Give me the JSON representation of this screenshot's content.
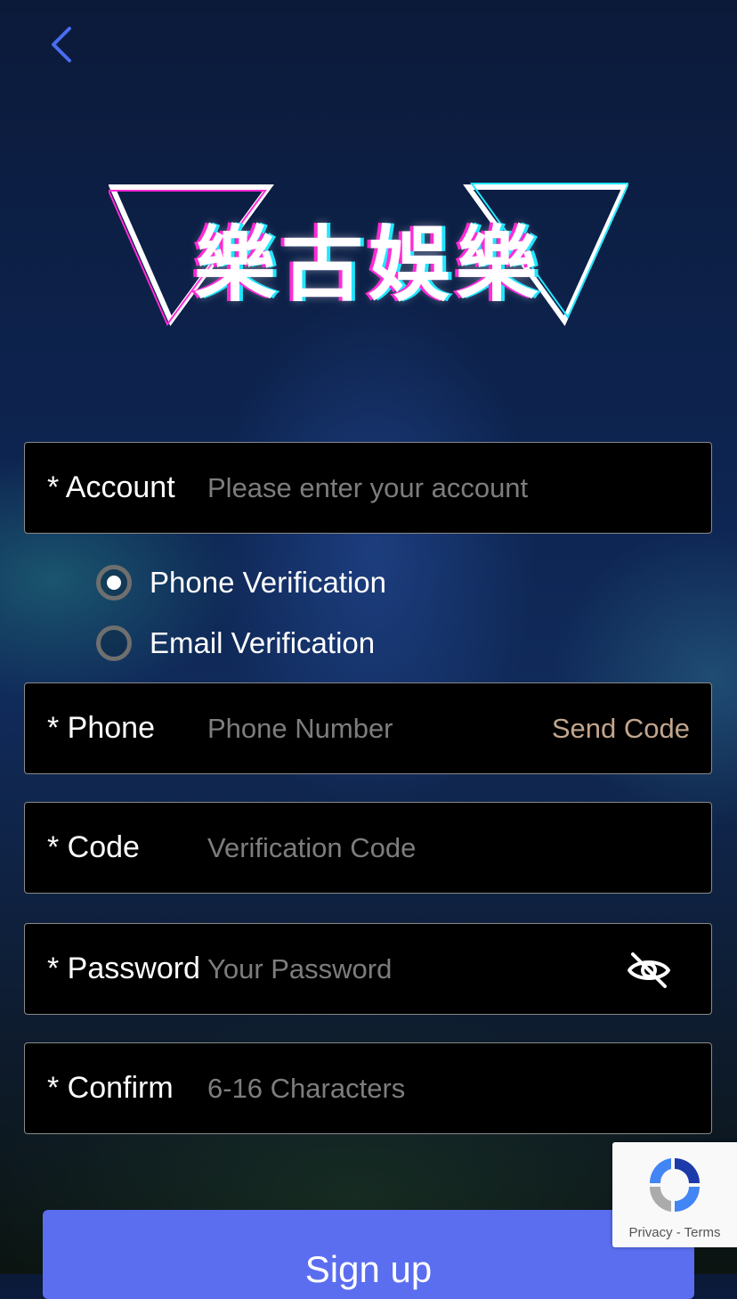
{
  "header": {
    "back_icon": "chevron-left-icon"
  },
  "logo": {
    "text": "樂古娛樂"
  },
  "form": {
    "account": {
      "label": "* Account",
      "placeholder": "Please enter your account"
    },
    "verification": {
      "options": [
        {
          "label": "Phone Verification",
          "selected": true
        },
        {
          "label": "Email Verification",
          "selected": false
        }
      ]
    },
    "phone": {
      "label": "* Phone",
      "placeholder": "Phone Number",
      "send_code": "Send Code"
    },
    "code": {
      "label": "* Code",
      "placeholder": "Verification Code"
    },
    "password": {
      "label": "* Password",
      "placeholder": "Your Password",
      "toggle_icon": "eye-off-icon"
    },
    "confirm": {
      "label": "* Confirm",
      "placeholder": "6-16 Characters"
    },
    "submit_label": "Sign up"
  },
  "recaptcha": {
    "links": "Privacy - Terms"
  },
  "colors": {
    "accent": "#5b6ef0",
    "send_code": "#c2a58c",
    "back": "#4a6cf0"
  }
}
